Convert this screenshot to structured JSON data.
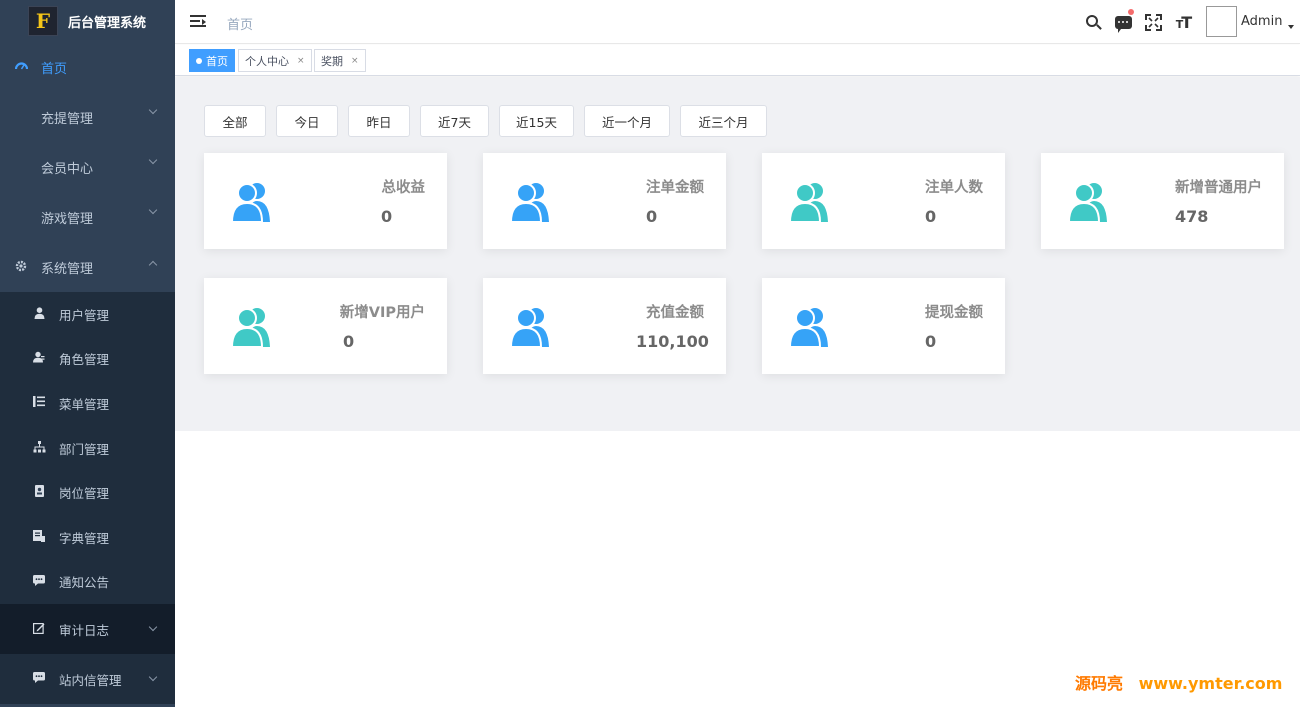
{
  "app": {
    "title": "后台管理系统",
    "logo_letter": "F"
  },
  "sidebar": {
    "items": [
      {
        "label": "首页",
        "icon": "dashboard-icon",
        "active": true
      },
      {
        "label": "充提管理",
        "icon": "",
        "expandable": true
      },
      {
        "label": "会员中心",
        "icon": "",
        "expandable": true
      },
      {
        "label": "游戏管理",
        "icon": "",
        "expandable": true
      },
      {
        "label": "系统管理",
        "icon": "gear-icon",
        "expandable": true,
        "expanded": true
      }
    ],
    "system_submenu": [
      {
        "label": "用户管理",
        "icon": "user-icon"
      },
      {
        "label": "角色管理",
        "icon": "role-icon"
      },
      {
        "label": "菜单管理",
        "icon": "menu-tree-icon"
      },
      {
        "label": "部门管理",
        "icon": "org-chart-icon"
      },
      {
        "label": "岗位管理",
        "icon": "badge-icon"
      },
      {
        "label": "字典管理",
        "icon": "dictionary-icon"
      },
      {
        "label": "通知公告",
        "icon": "notice-icon"
      },
      {
        "label": "审计日志",
        "icon": "edit-log-icon",
        "expandable": true
      },
      {
        "label": "站内信管理",
        "icon": "message-icon",
        "expandable": true
      }
    ]
  },
  "header": {
    "breadcrumb": "首页",
    "user_name": "Admin",
    "icons": [
      "search-icon",
      "message-icon",
      "fullscreen-icon",
      "font-size-icon"
    ]
  },
  "tags": [
    {
      "label": "首页",
      "active": true
    },
    {
      "label": "个人中心",
      "active": false
    },
    {
      "label": "奖期",
      "active": false
    }
  ],
  "filters": [
    "全部",
    "今日",
    "昨日",
    "近7天",
    "近15天",
    "近一个月",
    "近三个月"
  ],
  "cards": [
    {
      "label": "总收益",
      "value": "0",
      "icon_color": "#36a3f7"
    },
    {
      "label": "注单金额",
      "value": "0",
      "icon_color": "#36a3f7"
    },
    {
      "label": "注单人数",
      "value": "0",
      "icon_color": "#40c9c6"
    },
    {
      "label": "新增普通用户",
      "value": "478",
      "icon_color": "#40c9c6"
    },
    {
      "label": "新增VIP用户",
      "value": "0",
      "icon_color": "#40c9c6"
    },
    {
      "label": "充值金额",
      "value": "110,100",
      "icon_color": "#36a3f7"
    },
    {
      "label": "提现金额",
      "value": "0",
      "icon_color": "#36a3f7"
    }
  ],
  "watermark": {
    "brand": "源码亮",
    "url": "www.ymter.com"
  },
  "colors": {
    "sidebar_bg": "#304156",
    "submenu_bg": "#1f2d3d",
    "accent": "#409eff",
    "main_bg": "#f0f1f4"
  }
}
